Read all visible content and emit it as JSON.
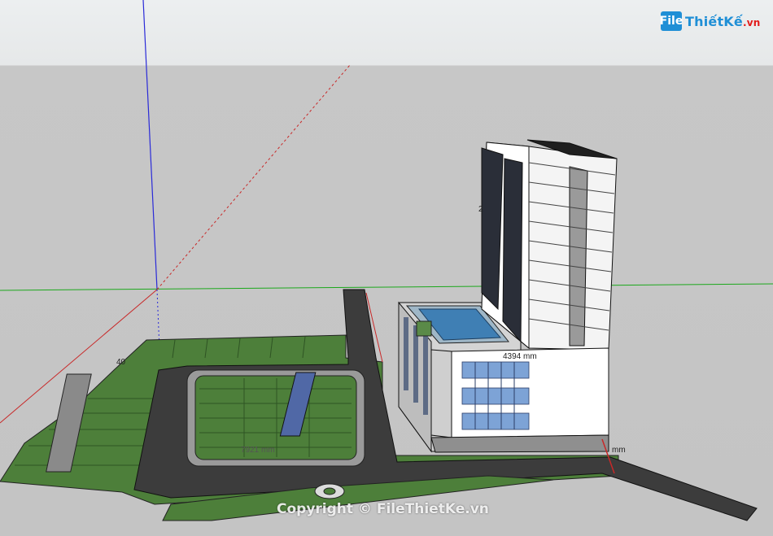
{
  "logo": {
    "mark": "File",
    "name": "ThiếtKế",
    "suffix": ".vn"
  },
  "dimensions": {
    "tower_height": "2",
    "tower_width": "4394 mm",
    "left_block": "40",
    "bottom_right": "mm",
    "parking": "7921 mm"
  },
  "watermark": "Copyright © FileThietKe.vn",
  "colors": {
    "grass": "#4d7f3a",
    "road": "#3c3c3c",
    "curb": "#a9a9a9",
    "pool": "#3f7fb4",
    "facade": "#ffffff",
    "glass": "#7da3d6",
    "axis_red": "#c82828",
    "axis_green": "#1ca81c",
    "axis_blue": "#2a2ad8"
  }
}
